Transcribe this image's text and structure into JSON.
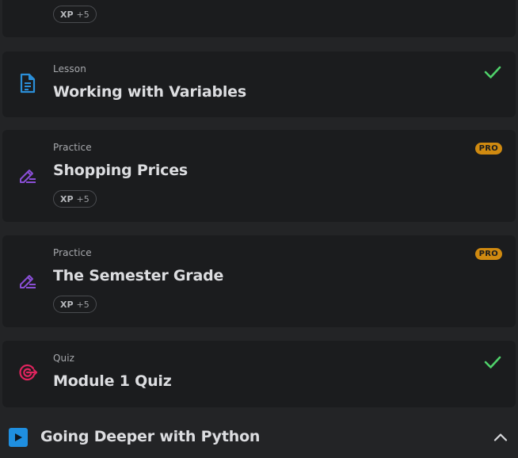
{
  "lessons": [
    {
      "type": "",
      "title": "",
      "xp_label": "XP",
      "xp_value": "+5",
      "status": "none"
    },
    {
      "type": "Lesson",
      "title": "Working with Variables",
      "icon": "lesson-document-icon",
      "status": "completed"
    },
    {
      "type": "Practice",
      "title": "Shopping Prices",
      "icon": "practice-pencil-icon",
      "xp_label": "XP",
      "xp_value": "+5",
      "badge": "PRO"
    },
    {
      "type": "Practice",
      "title": "The Semester Grade",
      "icon": "practice-pencil-icon",
      "xp_label": "XP",
      "xp_value": "+5",
      "badge": "PRO"
    },
    {
      "type": "Quiz",
      "title": "Module 1 Quiz",
      "icon": "quiz-target-icon",
      "status": "completed"
    }
  ],
  "module": {
    "title": "Going Deeper with Python",
    "icon": "play-icon",
    "expanded": true
  },
  "colors": {
    "page_bg": "#232426",
    "card_bg": "#1b1c1e",
    "lesson_icon": "#2b8fd9",
    "practice_icon": "#8a4fd6",
    "quiz_icon": "#e0245e",
    "check": "#4fd16a",
    "pro_badge": "#d08a10",
    "module_play": "#1f8fe0"
  }
}
